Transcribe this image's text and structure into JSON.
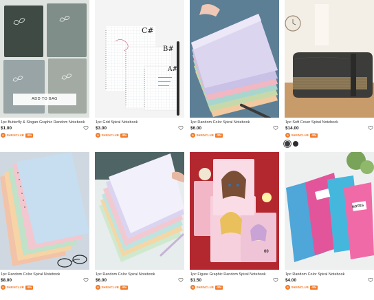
{
  "products": [
    {
      "title": "1pc Butterfly & Slogan Graphic Random Notebook",
      "price": "$1.00",
      "club": "SHEINCLUB",
      "discount": "-5%"
    },
    {
      "title": "1pc Grid Spiral Notebook",
      "price": "$3.00",
      "club": "SHEINCLUB",
      "discount": "-5%"
    },
    {
      "title": "1pc Random Color Spiral Notebook",
      "price": "$6.00",
      "club": "SHEINCLUB",
      "discount": "-5%"
    },
    {
      "title": "1pc Soft Cover Spiral Notebook",
      "price": "$14.00",
      "club": "SHEINCLUB",
      "discount": "-5%"
    },
    {
      "title": "1pc Random Color Spiral Notebook",
      "price": "$8.00",
      "club": "SHEINCLUB",
      "discount": "-5%"
    },
    {
      "title": "1pc Random Color Spiral Notebook",
      "price": "$6.00",
      "club": "SHEINCLUB",
      "discount": "-5%"
    },
    {
      "title": "1pc Figure Graphic Random Spiral Notebook",
      "price": "$1.50",
      "club": "SHEINCLUB",
      "discount": "-5%"
    },
    {
      "title": "1pc Random Color Spiral Notebook",
      "price": "$4.00",
      "club": "SHEINCLUB",
      "discount": "-5%"
    }
  ],
  "add_to_bag_label": "ADD TO BAG",
  "image_text": {
    "grid_labels": [
      "C#",
      "B#",
      "A#"
    ],
    "notes_label": "NOTES",
    "anime_number": "60"
  },
  "color_swatches": [
    "#3a3d3f",
    "#2b2d31"
  ],
  "colors": {
    "accent": "#f07b2b",
    "heart": "#666666"
  }
}
